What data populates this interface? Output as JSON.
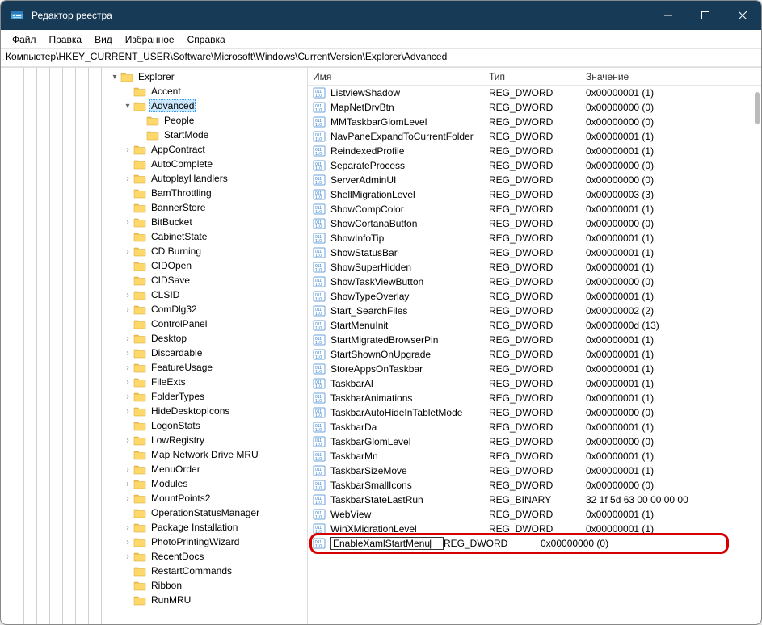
{
  "window": {
    "title": "Редактор реестра"
  },
  "menu": {
    "file": "Файл",
    "edit": "Правка",
    "view": "Вид",
    "favorites": "Избранное",
    "help": "Справка"
  },
  "address": "Компьютер\\HKEY_CURRENT_USER\\Software\\Microsoft\\Windows\\CurrentVersion\\Explorer\\Advanced",
  "columns": {
    "name": "Имя",
    "type": "Тип",
    "data": "Значение"
  },
  "tree": {
    "root": "Explorer",
    "selected": "Advanced",
    "children_selected": [
      "People",
      "StartMode"
    ],
    "siblings": [
      {
        "label": "Accent",
        "exp": ""
      },
      {
        "label": "Advanced",
        "exp": "open",
        "children": [
          "People",
          "StartMode"
        ],
        "selected": true
      },
      {
        "label": "AppContract",
        "exp": "closed"
      },
      {
        "label": "AutoComplete",
        "exp": ""
      },
      {
        "label": "AutoplayHandlers",
        "exp": "closed"
      },
      {
        "label": "BamThrottling",
        "exp": ""
      },
      {
        "label": "BannerStore",
        "exp": ""
      },
      {
        "label": "BitBucket",
        "exp": "closed"
      },
      {
        "label": "CabinetState",
        "exp": ""
      },
      {
        "label": "CD Burning",
        "exp": "closed"
      },
      {
        "label": "CIDOpen",
        "exp": ""
      },
      {
        "label": "CIDSave",
        "exp": ""
      },
      {
        "label": "CLSID",
        "exp": "closed"
      },
      {
        "label": "ComDlg32",
        "exp": "closed"
      },
      {
        "label": "ControlPanel",
        "exp": ""
      },
      {
        "label": "Desktop",
        "exp": "closed"
      },
      {
        "label": "Discardable",
        "exp": "closed"
      },
      {
        "label": "FeatureUsage",
        "exp": "closed"
      },
      {
        "label": "FileExts",
        "exp": "closed"
      },
      {
        "label": "FolderTypes",
        "exp": "closed"
      },
      {
        "label": "HideDesktopIcons",
        "exp": "closed"
      },
      {
        "label": "LogonStats",
        "exp": ""
      },
      {
        "label": "LowRegistry",
        "exp": "closed"
      },
      {
        "label": "Map Network Drive MRU",
        "exp": ""
      },
      {
        "label": "MenuOrder",
        "exp": "closed"
      },
      {
        "label": "Modules",
        "exp": "closed"
      },
      {
        "label": "MountPoints2",
        "exp": "closed"
      },
      {
        "label": "OperationStatusManager",
        "exp": ""
      },
      {
        "label": "Package Installation",
        "exp": "closed"
      },
      {
        "label": "PhotoPrintingWizard",
        "exp": "closed"
      },
      {
        "label": "RecentDocs",
        "exp": "closed"
      },
      {
        "label": "RestartCommands",
        "exp": ""
      },
      {
        "label": "Ribbon",
        "exp": ""
      },
      {
        "label": "RunMRU",
        "exp": ""
      }
    ]
  },
  "rows": [
    {
      "name": "ListviewShadow",
      "type": "REG_DWORD",
      "data": "0x00000001 (1)"
    },
    {
      "name": "MapNetDrvBtn",
      "type": "REG_DWORD",
      "data": "0x00000000 (0)"
    },
    {
      "name": "MMTaskbarGlomLevel",
      "type": "REG_DWORD",
      "data": "0x00000000 (0)"
    },
    {
      "name": "NavPaneExpandToCurrentFolder",
      "type": "REG_DWORD",
      "data": "0x00000001 (1)"
    },
    {
      "name": "ReindexedProfile",
      "type": "REG_DWORD",
      "data": "0x00000001 (1)"
    },
    {
      "name": "SeparateProcess",
      "type": "REG_DWORD",
      "data": "0x00000000 (0)"
    },
    {
      "name": "ServerAdminUI",
      "type": "REG_DWORD",
      "data": "0x00000000 (0)"
    },
    {
      "name": "ShellMigrationLevel",
      "type": "REG_DWORD",
      "data": "0x00000003 (3)"
    },
    {
      "name": "ShowCompColor",
      "type": "REG_DWORD",
      "data": "0x00000001 (1)"
    },
    {
      "name": "ShowCortanaButton",
      "type": "REG_DWORD",
      "data": "0x00000000 (0)"
    },
    {
      "name": "ShowInfoTip",
      "type": "REG_DWORD",
      "data": "0x00000001 (1)"
    },
    {
      "name": "ShowStatusBar",
      "type": "REG_DWORD",
      "data": "0x00000001 (1)"
    },
    {
      "name": "ShowSuperHidden",
      "type": "REG_DWORD",
      "data": "0x00000001 (1)"
    },
    {
      "name": "ShowTaskViewButton",
      "type": "REG_DWORD",
      "data": "0x00000000 (0)"
    },
    {
      "name": "ShowTypeOverlay",
      "type": "REG_DWORD",
      "data": "0x00000001 (1)"
    },
    {
      "name": "Start_SearchFiles",
      "type": "REG_DWORD",
      "data": "0x00000002 (2)"
    },
    {
      "name": "StartMenuInit",
      "type": "REG_DWORD",
      "data": "0x0000000d (13)"
    },
    {
      "name": "StartMigratedBrowserPin",
      "type": "REG_DWORD",
      "data": "0x00000001 (1)"
    },
    {
      "name": "StartShownOnUpgrade",
      "type": "REG_DWORD",
      "data": "0x00000001 (1)"
    },
    {
      "name": "StoreAppsOnTaskbar",
      "type": "REG_DWORD",
      "data": "0x00000001 (1)"
    },
    {
      "name": "TaskbarAl",
      "type": "REG_DWORD",
      "data": "0x00000001 (1)"
    },
    {
      "name": "TaskbarAnimations",
      "type": "REG_DWORD",
      "data": "0x00000001 (1)"
    },
    {
      "name": "TaskbarAutoHideInTabletMode",
      "type": "REG_DWORD",
      "data": "0x00000000 (0)"
    },
    {
      "name": "TaskbarDa",
      "type": "REG_DWORD",
      "data": "0x00000001 (1)"
    },
    {
      "name": "TaskbarGlomLevel",
      "type": "REG_DWORD",
      "data": "0x00000000 (0)"
    },
    {
      "name": "TaskbarMn",
      "type": "REG_DWORD",
      "data": "0x00000001 (1)"
    },
    {
      "name": "TaskbarSizeMove",
      "type": "REG_DWORD",
      "data": "0x00000001 (1)"
    },
    {
      "name": "TaskbarSmallIcons",
      "type": "REG_DWORD",
      "data": "0x00000000 (0)"
    },
    {
      "name": "TaskbarStateLastRun",
      "type": "REG_BINARY",
      "data": "32 1f 5d 63 00 00 00 00"
    },
    {
      "name": "WebView",
      "type": "REG_DWORD",
      "data": "0x00000001 (1)"
    },
    {
      "name": "WinXMigrationLevel",
      "type": "REG_DWORD",
      "data": "0x00000001 (1)"
    },
    {
      "name": "EnableXamlStartMenu",
      "type": "REG_DWORD",
      "data": "0x00000000 (0)",
      "editing": true
    }
  ]
}
